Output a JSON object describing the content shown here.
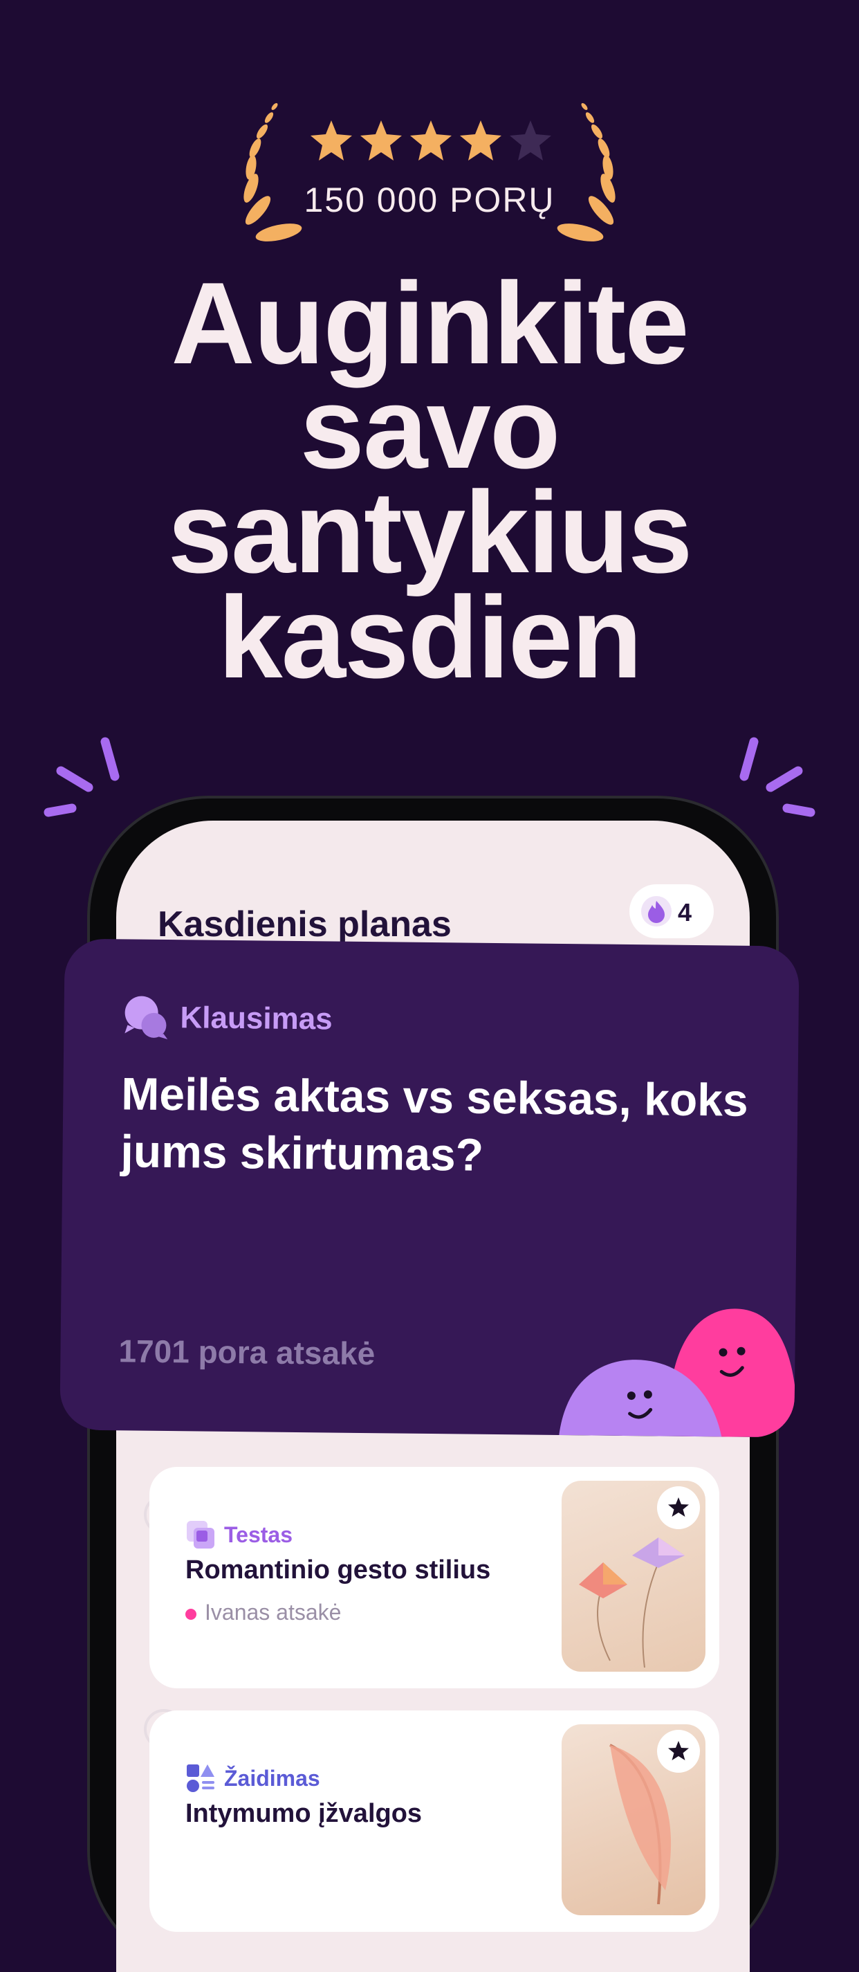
{
  "rating": {
    "stars_value": 4.5,
    "stars_max": 5,
    "text": "150 000 PORŲ"
  },
  "headline": [
    "Auginkite",
    "savo",
    "santykius",
    "kasdien"
  ],
  "app": {
    "plan_title": "Kasdienis planas",
    "streak_count": "4",
    "question_card": {
      "tag": "Klausimas",
      "question": "Meilės aktas vs seksas, koks jums skirtumas?",
      "answered": "1701 pora atsakė"
    },
    "activities": [
      {
        "tag": "Testas",
        "title": "Romantinio gesto stilius",
        "meta": "Ivanas atsakė",
        "tag_color": "#9b5de5"
      },
      {
        "tag": "Žaidimas",
        "title": "Intymumo įžvalgos",
        "meta": "",
        "tag_color": "#5b5bd6"
      }
    ]
  },
  "colors": {
    "background": "#1e0b33",
    "card": "#361856",
    "accent_purple": "#b783f2",
    "accent_pink": "#ff3d9e",
    "star": "#f4b061"
  },
  "icons": {
    "laurel": "laurel-icon",
    "star": "star-icon",
    "flame": "flame-icon",
    "question": "speech-bubbles-icon",
    "test": "squares-icon",
    "game": "shapes-icon",
    "bookmark": "star-icon"
  }
}
